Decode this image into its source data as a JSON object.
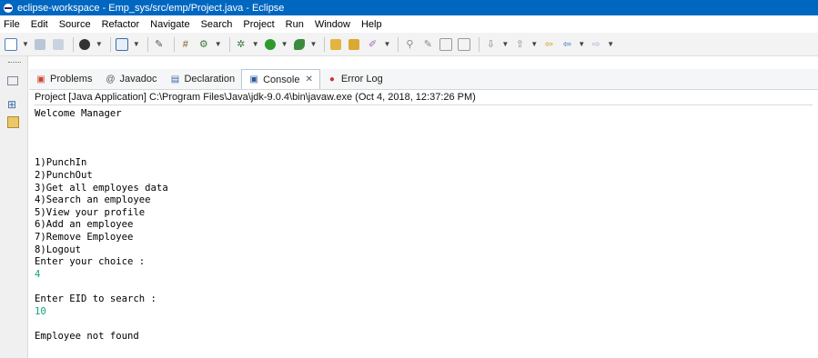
{
  "window": {
    "title": "eclipse-workspace - Emp_sys/src/emp/Project.java - Eclipse"
  },
  "menu": [
    "File",
    "Edit",
    "Source",
    "Refactor",
    "Navigate",
    "Search",
    "Project",
    "Run",
    "Window",
    "Help"
  ],
  "toolbar_icons": [
    "new-icon",
    "save-icon",
    "save-all-icon",
    "debug-profile-icon",
    "console-view-icon",
    "pen-icon",
    "open-type-icon",
    "gear-icon",
    "debug-icon",
    "run-icon",
    "external-tools-icon",
    "open-folder-icon",
    "open-folder-2-icon",
    "brush-icon",
    "pin-icon",
    "edit-icon",
    "grid-icon",
    "table-icon",
    "next-annotation-icon",
    "prev-annotation-icon",
    "back-icon",
    "forward-icon"
  ],
  "tabs": [
    {
      "label": "Problems",
      "icon": "problems-icon"
    },
    {
      "label": "Javadoc",
      "icon": "javadoc-icon"
    },
    {
      "label": "Declaration",
      "icon": "declaration-icon"
    },
    {
      "label": "Console",
      "icon": "console-icon",
      "active": true,
      "close": "✕"
    },
    {
      "label": "Error Log",
      "icon": "error-log-icon"
    }
  ],
  "console": {
    "description": "Project [Java Application] C:\\Program Files\\Java\\jdk-9.0.4\\bin\\javaw.exe (Oct 4, 2018, 12:37:26 PM)",
    "lines": [
      {
        "text": "Welcome Manager",
        "type": "out"
      },
      {
        "text": "",
        "type": "out"
      },
      {
        "text": "",
        "type": "out"
      },
      {
        "text": "",
        "type": "out"
      },
      {
        "text": "1)PunchIn",
        "type": "out"
      },
      {
        "text": "2)PunchOut",
        "type": "out"
      },
      {
        "text": "3)Get all employes data",
        "type": "out"
      },
      {
        "text": "4)Search an employee",
        "type": "out"
      },
      {
        "text": "5)View your profile",
        "type": "out"
      },
      {
        "text": "6)Add an employee",
        "type": "out"
      },
      {
        "text": "7)Remove Employee",
        "type": "out"
      },
      {
        "text": "8)Logout",
        "type": "out"
      },
      {
        "text": "Enter your choice :",
        "type": "out"
      },
      {
        "text": "4",
        "type": "in"
      },
      {
        "text": "",
        "type": "out"
      },
      {
        "text": "Enter EID to search :",
        "type": "out"
      },
      {
        "text": "10",
        "type": "in"
      },
      {
        "text": "",
        "type": "out"
      },
      {
        "text": "Employee not found",
        "type": "out"
      }
    ]
  },
  "colors": {
    "titlebar": "#0067c0",
    "input_text": "#11a47f"
  }
}
